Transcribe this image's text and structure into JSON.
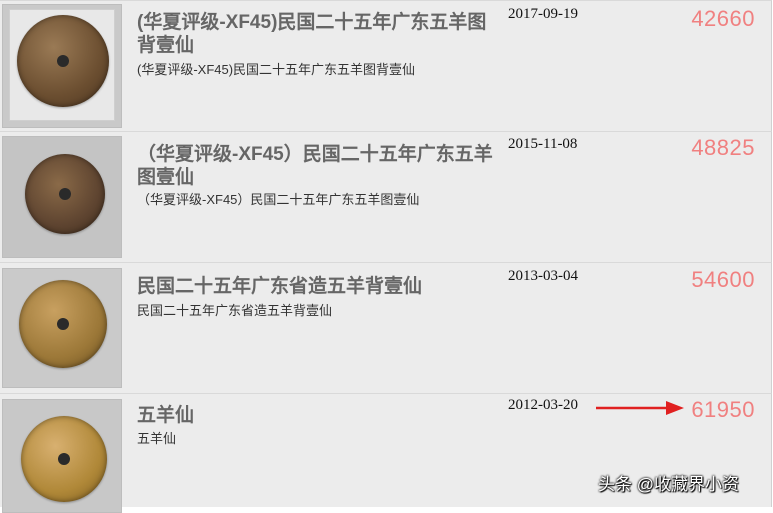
{
  "listings": [
    {
      "title": "(华夏评级-XF45)民国二十五年广东五羊图背壹仙",
      "subtitle": "(华夏评级-XF45)民国二十五年广东五羊图背壹仙",
      "date": "2017-09-19",
      "price": "42660"
    },
    {
      "title": "（华夏评级-XF45）民国二十五年广东五羊图壹仙",
      "subtitle": "（华夏评级-XF45）民国二十五年广东五羊图壹仙",
      "date": "2015-11-08",
      "price": "48825"
    },
    {
      "title": "民国二十五年广东省造五羊背壹仙",
      "subtitle": "民国二十五年广东省造五羊背壹仙",
      "date": "2013-03-04",
      "price": "54600"
    },
    {
      "title": "五羊仙",
      "subtitle": "五羊仙",
      "date": "2012-03-20",
      "price": "61950"
    }
  ],
  "watermark": "头条 @收藏界小资",
  "colors": {
    "price": "#f08080",
    "arrow": "#e02020",
    "row_bg": "#ececec"
  },
  "icons": {
    "arrow": "right-arrow-icon"
  }
}
